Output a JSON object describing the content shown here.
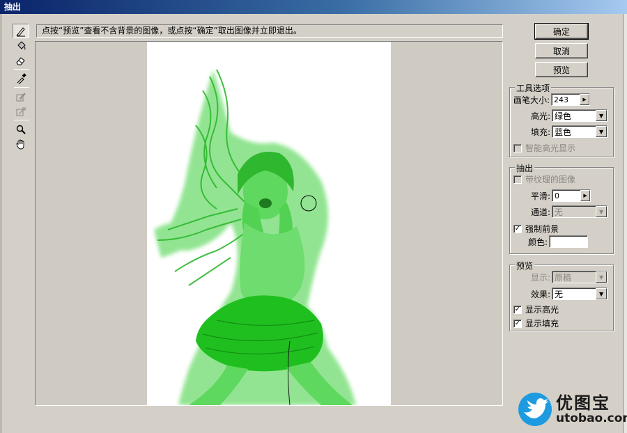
{
  "window": {
    "title": "抽出"
  },
  "toolbar": {
    "tools": [
      {
        "name": "edge-highlighter-tool",
        "active": true
      },
      {
        "name": "fill-tool"
      },
      {
        "name": "eraser-tool"
      },
      {
        "name": "eyedropper-tool"
      },
      {
        "name": "cleanup-tool"
      },
      {
        "name": "edge-touchup-tool"
      },
      {
        "name": "zoom-tool"
      },
      {
        "name": "hand-tool"
      }
    ]
  },
  "hint_text": "点按“预览”查看不含背景的图像，或点按“确定”取出图像并立即退出。",
  "buttons": {
    "ok": "确定",
    "cancel": "取消",
    "preview": "预览"
  },
  "tool_options": {
    "title": "工具选项",
    "brush_size_label": "画笔大小:",
    "brush_size_value": "243",
    "highlight_label": "高光:",
    "highlight_value": "绿色",
    "fill_label": "填充:",
    "fill_value": "蓝色",
    "smart_highlight_label": "智能高光显示",
    "smart_highlight_checked": false
  },
  "extraction": {
    "title": "抽出",
    "textured_label": "带纹理的图像",
    "textured_checked": false,
    "smooth_label": "平滑:",
    "smooth_value": "0",
    "channel_label": "通道:",
    "channel_value": "无",
    "force_fg_label": "强制前景",
    "force_fg_checked": true,
    "color_label": "颜色:",
    "color_value": "#ffffff"
  },
  "preview": {
    "title": "预览",
    "show_label": "显示:",
    "show_value": "原稿",
    "effect_label": "效果:",
    "effect_value": "无",
    "show_highlight_label": "显示高光",
    "show_highlight_checked": true,
    "show_fill_label": "显示填充",
    "show_fill_checked": true
  },
  "colors": {
    "highlight": "#2ecc2e",
    "highlight_halo": "#7fe07f",
    "title_bar": "#0a246a",
    "face": "#d4d0c8"
  },
  "watermark": {
    "name": "优图宝",
    "url": "utobao.com"
  }
}
